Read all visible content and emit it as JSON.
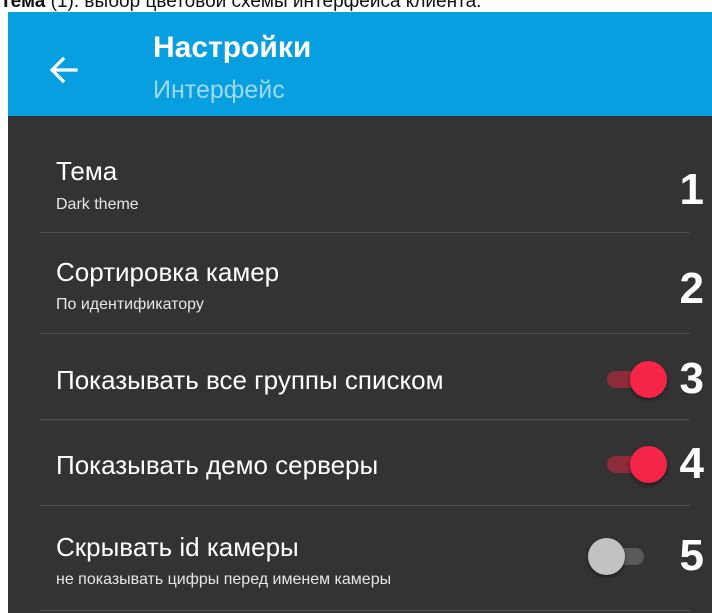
{
  "caption": {
    "bold": "Тема",
    "rest": " (1): выбор цветовой схемы интерфейса клиента."
  },
  "header": {
    "back_icon": "arrow-left-icon",
    "title": "Настройки",
    "subtitle": "Интерфейс"
  },
  "colors": {
    "appbar": "#079fe0",
    "background": "#333333",
    "switch_on": "#f5254a",
    "switch_off": "#c2c2c2"
  },
  "settings": [
    {
      "title": "Тема",
      "subtitle": "Dark theme",
      "number": "1"
    },
    {
      "title": "Сортировка камер",
      "subtitle": "По идентификатору",
      "number": "2"
    },
    {
      "title": "Показывать все группы списком",
      "toggle": true,
      "number": "3"
    },
    {
      "title": "Показывать демо серверы",
      "toggle": true,
      "number": "4"
    },
    {
      "title": "Скрывать id камеры",
      "subtitle": "не показывать цифры перед именем камеры",
      "toggle": false,
      "number": "5"
    }
  ]
}
